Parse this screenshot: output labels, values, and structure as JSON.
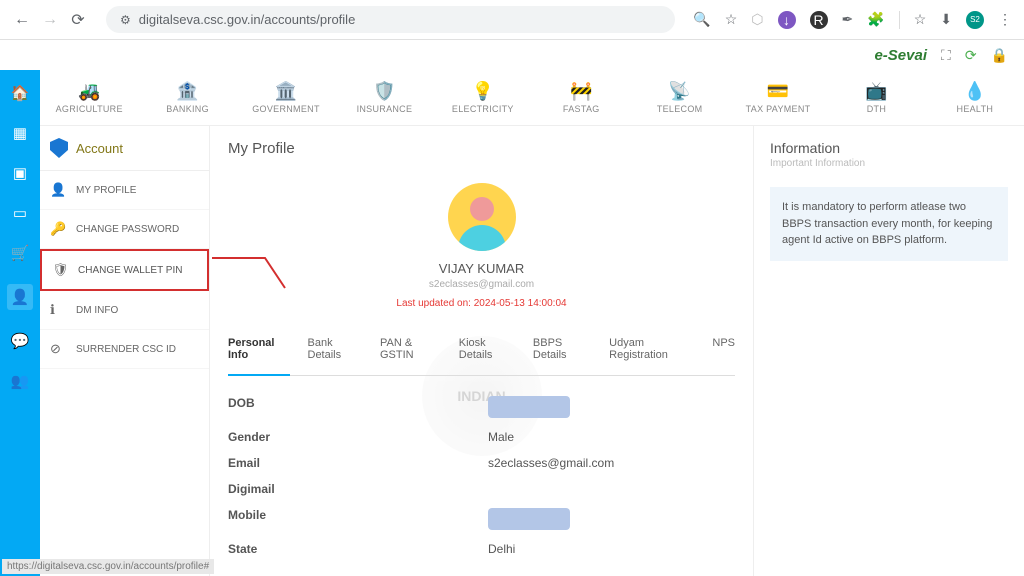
{
  "browser": {
    "url": "digitalseva.csc.gov.in/accounts/profile"
  },
  "brand": {
    "name": "e-Sevai"
  },
  "categories": [
    {
      "icon": "🚜",
      "label": "AGRICULTURE"
    },
    {
      "icon": "🏦",
      "label": "BANKING"
    },
    {
      "icon": "🏛️",
      "label": "GOVERNMENT"
    },
    {
      "icon": "🛡️",
      "label": "INSURANCE"
    },
    {
      "icon": "💡",
      "label": "ELECTRICITY"
    },
    {
      "icon": "🚧",
      "label": "FASTAG"
    },
    {
      "icon": "📡",
      "label": "TELECOM"
    },
    {
      "icon": "💳",
      "label": "TAX PAYMENT"
    },
    {
      "icon": "📺",
      "label": "DTH"
    },
    {
      "icon": "💧",
      "label": "HEALTH"
    }
  ],
  "account": {
    "title": "Account",
    "items": [
      {
        "icon": "👤",
        "label": "MY PROFILE"
      },
      {
        "icon": "🔑",
        "label": "CHANGE PASSWORD"
      },
      {
        "icon": "🛡",
        "label": "CHANGE WALLET PIN"
      },
      {
        "icon": "ℹ",
        "label": "DM INFO"
      },
      {
        "icon": "⊘",
        "label": "SURRENDER CSC ID"
      }
    ]
  },
  "profile": {
    "title": "My Profile",
    "name": "VIJAY KUMAR",
    "email": "s2eclasses@gmail.com",
    "updated": "Last updated on: 2024-05-13 14:00:04",
    "tabs": [
      "Personal Info",
      "Bank Details",
      "PAN & GSTIN",
      "Kiosk Details",
      "BBPS Details",
      "Udyam Registration",
      "NPS"
    ],
    "fields": [
      {
        "label": "DOB",
        "value": "",
        "redacted": true
      },
      {
        "label": "Gender",
        "value": "Male",
        "redacted": false
      },
      {
        "label": "Email",
        "value": "s2eclasses@gmail.com",
        "redacted": false
      },
      {
        "label": "Digimail",
        "value": "",
        "redacted": false
      },
      {
        "label": "Mobile",
        "value": "",
        "redacted": true
      },
      {
        "label": "State",
        "value": "Delhi",
        "redacted": false
      }
    ]
  },
  "info": {
    "title": "Information",
    "subtitle": "Important Information",
    "notice": "It is mandatory to perform atlease two BBPS transaction every month, for keeping agent Id active on BBPS platform."
  },
  "status_url": "https://digitalseva.csc.gov.in/accounts/profile#"
}
